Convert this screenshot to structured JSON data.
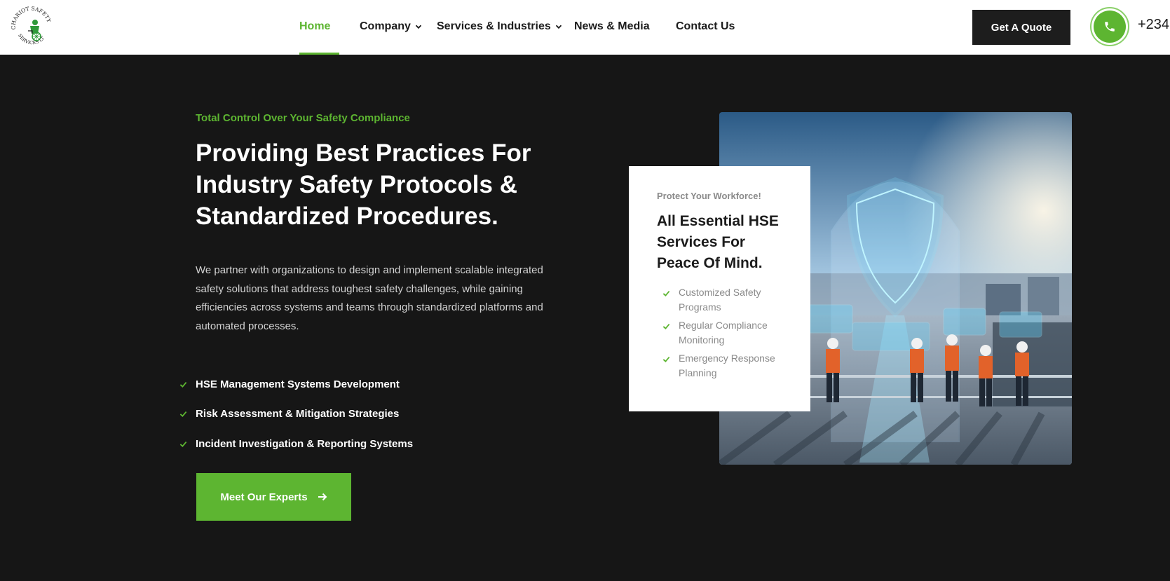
{
  "header": {
    "logo": {
      "text_top": "CHARIOT SAFETY",
      "text_bottom": "SERVICES LTD"
    },
    "nav": [
      {
        "label": "Home",
        "active": true,
        "has_dropdown": false
      },
      {
        "label": "Company",
        "active": false,
        "has_dropdown": true
      },
      {
        "label": "Services & Industries",
        "active": false,
        "has_dropdown": true
      },
      {
        "label": "News & Media",
        "active": false,
        "has_dropdown": false
      },
      {
        "label": "Contact Us",
        "active": false,
        "has_dropdown": false
      }
    ],
    "quote_button": "Get A Quote",
    "phone_text": "+234"
  },
  "hero": {
    "eyebrow": "Total Control Over Your Safety Compliance",
    "title": "Providing Best Practices For Industry Safety Protocols & Standardized Procedures.",
    "description": "We partner with organizations to design and implement scalable integrated safety solutions that address toughest safety challenges, while gaining efficiencies across systems and teams through standardized platforms and automated processes.",
    "features": [
      "HSE Management Systems Development",
      "Risk Assessment & Mitigation Strategies",
      "Incident Investigation & Reporting Systems"
    ],
    "cta_label": "Meet Our Experts"
  },
  "card": {
    "eyebrow": "Protect Your Workforce!",
    "title": "All Essential HSE Services For Peace Of Mind.",
    "items": [
      "Customized Safety Programs",
      "Regular Compliance Monitoring",
      "Emergency Response Planning"
    ]
  },
  "colors": {
    "brand_green": "#5db531",
    "dark_bg": "#161616",
    "button_dark": "#1d1d1d"
  }
}
